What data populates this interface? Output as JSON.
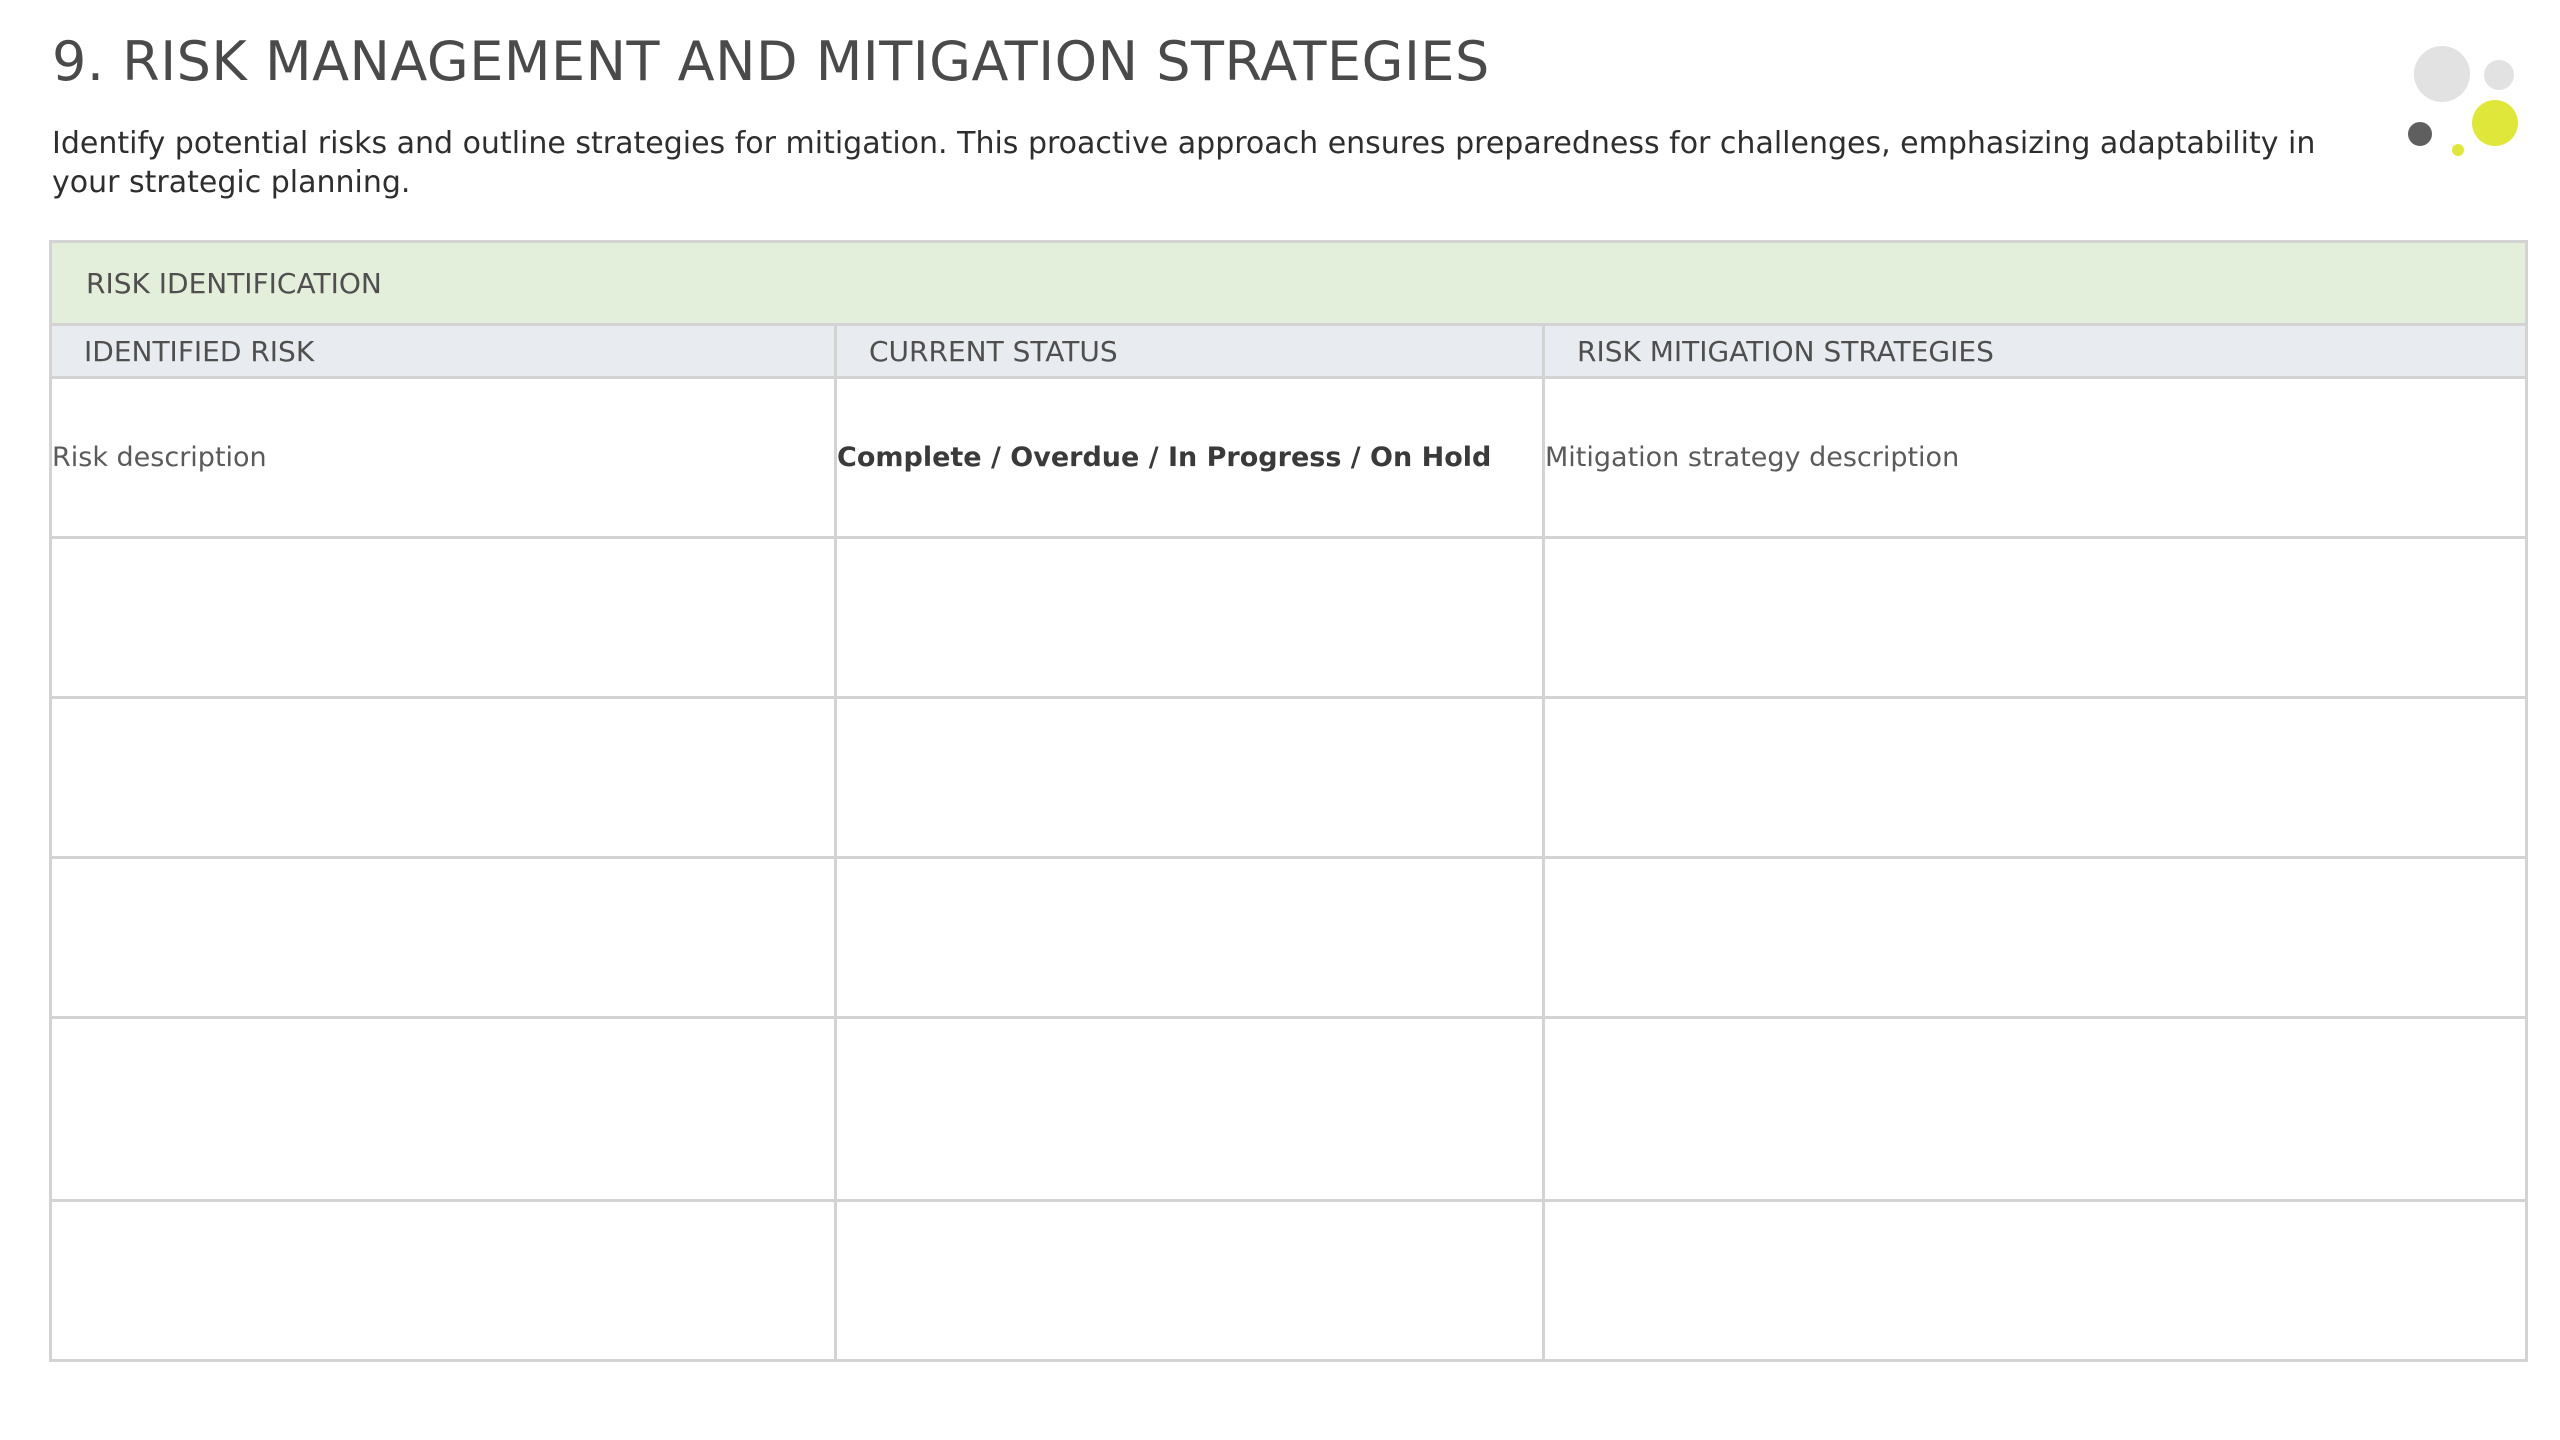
{
  "page": {
    "title": "9. RISK MANAGEMENT AND MITIGATION STRATEGIES",
    "subtitle": "Identify potential risks and outline strategies for mitigation. This proactive approach ensures preparedness for challenges, emphasizing adaptability in your strategic planning."
  },
  "colors": {
    "section_header_bg": "#e3eedb",
    "column_header_bg": "#e8ebf0",
    "border": "#d3d3d3",
    "accent_yellow": "#dfe73a",
    "dot_dark": "#5f5f5f",
    "dot_light": "#e2e2e2"
  },
  "logo": {
    "icon": "decorative-dots-icon"
  },
  "table": {
    "section_label": "RISK IDENTIFICATION",
    "columns": [
      "IDENTIFIED RISK",
      "CURRENT STATUS",
      "RISK MITIGATION STRATEGIES"
    ],
    "rows": [
      {
        "risk": "Risk description",
        "status": "Complete / Overdue / In Progress / On Hold",
        "mitigation": "Mitigation strategy description"
      },
      {
        "risk": "",
        "status": "",
        "mitigation": ""
      },
      {
        "risk": "",
        "status": "",
        "mitigation": ""
      },
      {
        "risk": "",
        "status": "",
        "mitigation": ""
      },
      {
        "risk": "",
        "status": "",
        "mitigation": ""
      },
      {
        "risk": "",
        "status": "",
        "mitigation": ""
      }
    ]
  }
}
